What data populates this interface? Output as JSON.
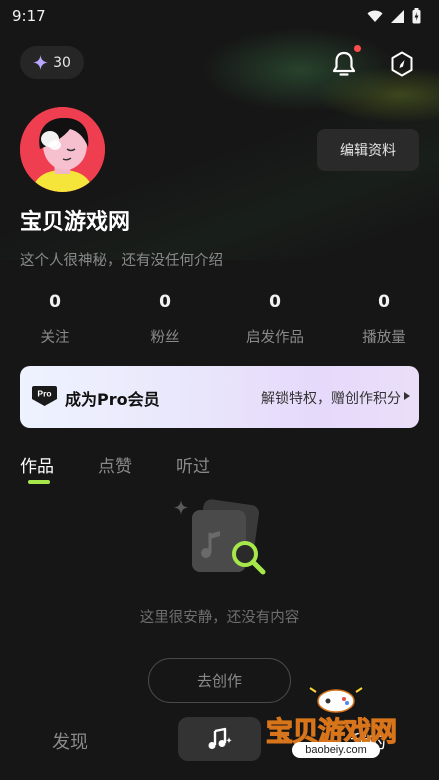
{
  "status_bar": {
    "time": "9:17",
    "icons": [
      "wifi-icon",
      "signal-icon",
      "battery-charging-icon"
    ]
  },
  "header": {
    "coins": "30",
    "coin_icon": "sparkle-icon",
    "notification_icon": "bell-icon",
    "settings_icon": "hexagon-settings-icon"
  },
  "profile": {
    "edit_label": "编辑资料",
    "name": "宝贝游戏网",
    "bio": "这个人很神秘，还有没任何介绍",
    "stats": [
      {
        "value": "0",
        "label": "关注"
      },
      {
        "value": "0",
        "label": "粉丝"
      },
      {
        "value": "0",
        "label": "启发作品"
      },
      {
        "value": "0",
        "label": "播放量"
      }
    ]
  },
  "pro_banner": {
    "badge": "Pro",
    "title": "成为Pro会员",
    "description": "解锁特权，赠创作积分"
  },
  "tabs": [
    {
      "label": "作品",
      "active": true
    },
    {
      "label": "点赞",
      "active": false
    },
    {
      "label": "听过",
      "active": false
    }
  ],
  "empty_state": {
    "message": "这里很安静，还没有内容",
    "button": "去创作"
  },
  "bottom_nav": {
    "discover": "发现",
    "create_icon": "music-note-sparkle-icon",
    "mine": "我的"
  },
  "watermark": {
    "title": "宝贝游戏网",
    "domain": "baobeiy.com"
  },
  "colors": {
    "accent": "#a6e84a",
    "background": "#161616",
    "avatar_bg": "#ee3e4f",
    "notification_dot": "#ff4d4f"
  }
}
